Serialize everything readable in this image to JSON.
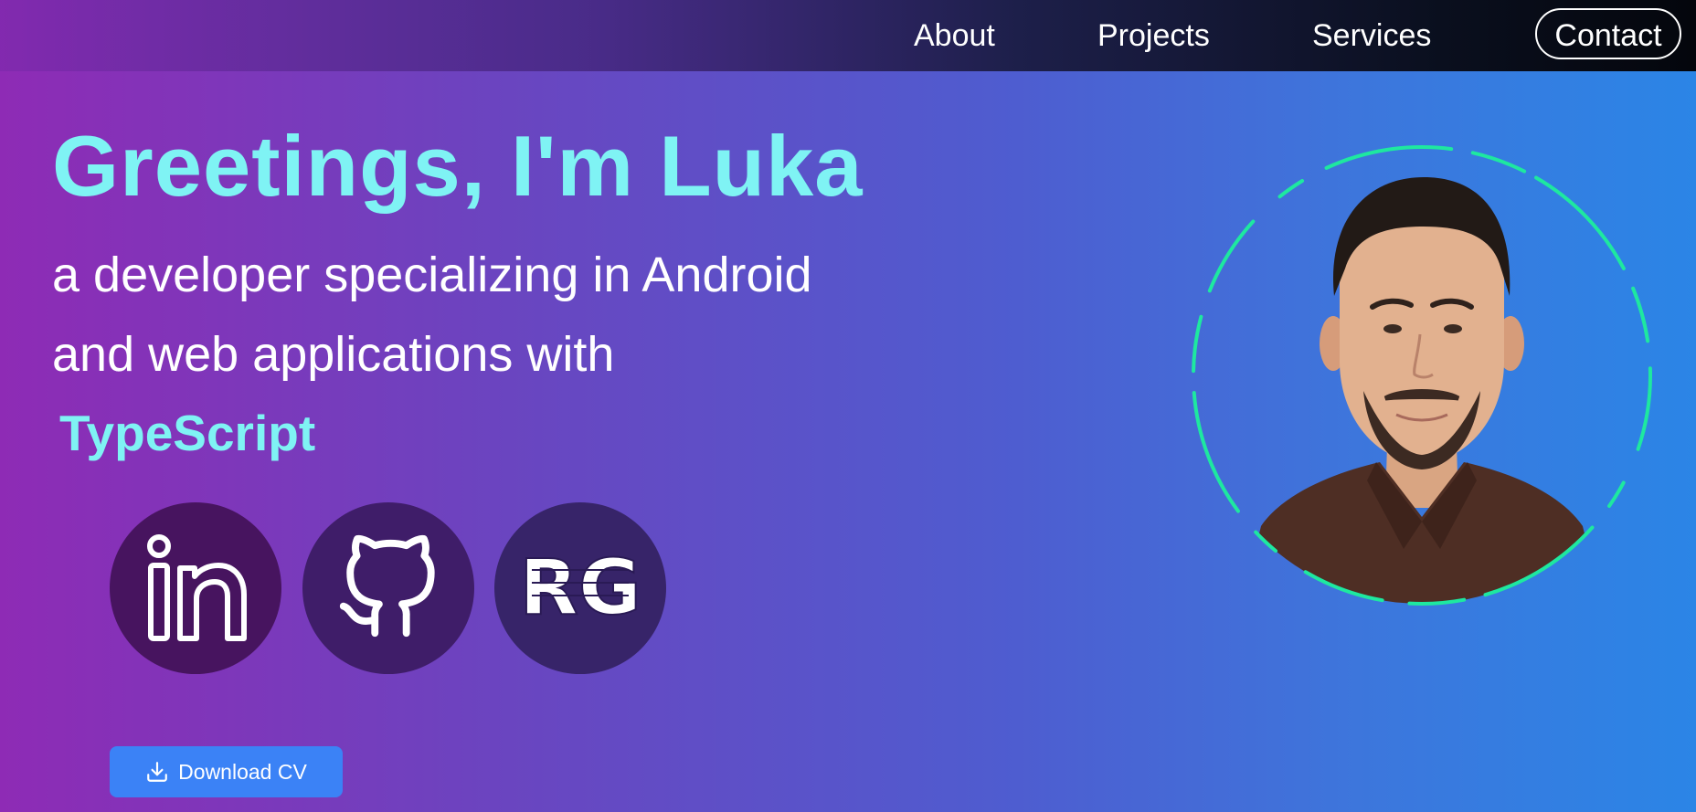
{
  "nav": {
    "about": "About",
    "projects": "Projects",
    "services": "Services",
    "contact": "Contact"
  },
  "hero": {
    "headline": "Greetings, I'm Luka",
    "subline_1": "a developer specializing in Android",
    "subline_2": "and web applications with",
    "typed_word": "TypeScript"
  },
  "social": [
    {
      "name": "linkedin",
      "icon": "linkedin-icon"
    },
    {
      "name": "github",
      "icon": "github-icon"
    },
    {
      "name": "researchgate",
      "icon": "researchgate-icon",
      "glyph": "RG"
    }
  ],
  "download": {
    "label": "Download CV",
    "icon": "download-icon"
  },
  "profile": {
    "icon": "profile-photo"
  },
  "colors": {
    "accent_cyan": "#7ff3f4",
    "ring_green": "#1ee8a0",
    "button_blue": "#3b82f6"
  }
}
